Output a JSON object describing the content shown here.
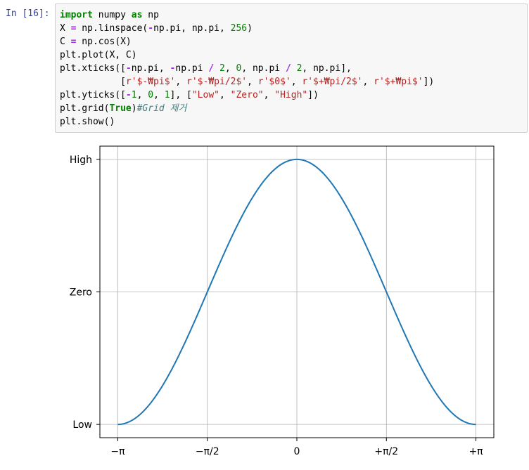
{
  "cell": {
    "prompt": "In [16]:",
    "code_lines": [
      [
        {
          "t": "import",
          "c": "kw"
        },
        {
          "t": " numpy ",
          "c": ""
        },
        {
          "t": "as",
          "c": "kw"
        },
        {
          "t": " np",
          "c": ""
        }
      ],
      [
        {
          "t": "X ",
          "c": ""
        },
        {
          "t": "=",
          "c": "op"
        },
        {
          "t": " np.linspace(",
          "c": ""
        },
        {
          "t": "-",
          "c": "op"
        },
        {
          "t": "np.pi, np.pi, ",
          "c": ""
        },
        {
          "t": "256",
          "c": "num"
        },
        {
          "t": ")",
          "c": ""
        }
      ],
      [
        {
          "t": "C ",
          "c": ""
        },
        {
          "t": "=",
          "c": "op"
        },
        {
          "t": " np.cos(X)",
          "c": ""
        }
      ],
      [
        {
          "t": "plt.plot(X, C)",
          "c": ""
        }
      ],
      [
        {
          "t": "plt.xticks([",
          "c": ""
        },
        {
          "t": "-",
          "c": "op"
        },
        {
          "t": "np.pi, ",
          "c": ""
        },
        {
          "t": "-",
          "c": "op"
        },
        {
          "t": "np.pi ",
          "c": ""
        },
        {
          "t": "/",
          "c": "op"
        },
        {
          "t": " ",
          "c": ""
        },
        {
          "t": "2",
          "c": "num"
        },
        {
          "t": ", ",
          "c": ""
        },
        {
          "t": "0",
          "c": "num"
        },
        {
          "t": ", np.pi ",
          "c": ""
        },
        {
          "t": "/",
          "c": "op"
        },
        {
          "t": " ",
          "c": ""
        },
        {
          "t": "2",
          "c": "num"
        },
        {
          "t": ", np.pi],",
          "c": ""
        }
      ],
      [
        {
          "t": "           [",
          "c": ""
        },
        {
          "t": "r'$-₩pi$'",
          "c": "str"
        },
        {
          "t": ", ",
          "c": ""
        },
        {
          "t": "r'$-₩pi/2$'",
          "c": "str"
        },
        {
          "t": ", ",
          "c": ""
        },
        {
          "t": "r'$0$'",
          "c": "str"
        },
        {
          "t": ", ",
          "c": ""
        },
        {
          "t": "r'$+₩pi/2$'",
          "c": "str"
        },
        {
          "t": ", ",
          "c": ""
        },
        {
          "t": "r'$+₩pi$'",
          "c": "str"
        },
        {
          "t": "])",
          "c": ""
        }
      ],
      [
        {
          "t": "plt.yticks([",
          "c": ""
        },
        {
          "t": "-",
          "c": "op"
        },
        {
          "t": "1",
          "c": "num"
        },
        {
          "t": ", ",
          "c": ""
        },
        {
          "t": "0",
          "c": "num"
        },
        {
          "t": ", ",
          "c": ""
        },
        {
          "t": "1",
          "c": "num"
        },
        {
          "t": "], [",
          "c": ""
        },
        {
          "t": "\"Low\"",
          "c": "str"
        },
        {
          "t": ", ",
          "c": ""
        },
        {
          "t": "\"Zero\"",
          "c": "str"
        },
        {
          "t": ", ",
          "c": ""
        },
        {
          "t": "\"High\"",
          "c": "str"
        },
        {
          "t": "])",
          "c": ""
        }
      ],
      [
        {
          "t": "plt.grid(",
          "c": ""
        },
        {
          "t": "True",
          "c": "kw"
        },
        {
          "t": ")",
          "c": ""
        },
        {
          "t": "#Grid 제거",
          "c": "cm"
        }
      ],
      [
        {
          "t": "plt.show()",
          "c": ""
        }
      ]
    ]
  },
  "chart_data": {
    "type": "line",
    "function": "cos",
    "series": [
      {
        "values_source": "C = np.cos(X)",
        "x_range": [
          -3.14159,
          3.14159
        ],
        "points": 256
      }
    ],
    "xlim": [
      -3.4557,
      3.4557
    ],
    "ylim": [
      -1.1,
      1.1
    ],
    "xticks": [
      -3.14159,
      -1.5708,
      0,
      1.5708,
      3.14159
    ],
    "xtick_labels": [
      "−π",
      "−π/2",
      "0",
      "+π/2",
      "+π"
    ],
    "yticks": [
      -1,
      0,
      1
    ],
    "ytick_labels": [
      "Low",
      "Zero",
      "High"
    ],
    "grid": true,
    "line_color": "#1f77b4"
  }
}
